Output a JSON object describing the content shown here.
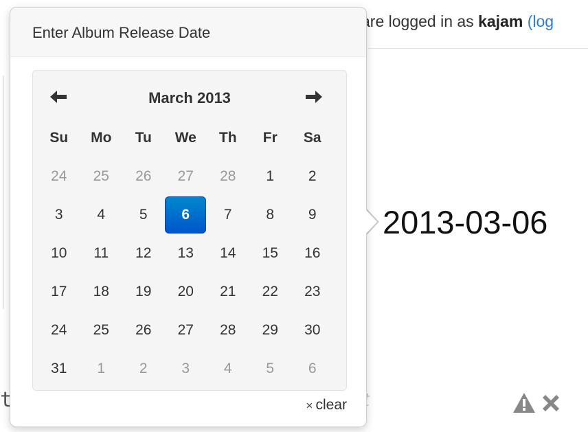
{
  "header": {
    "login_prefix": "are logged in as",
    "username": "kajam",
    "logout_fragment": "(log"
  },
  "background": {
    "left_fragment": "t",
    "mid_fragment": "t"
  },
  "release_date": {
    "value": "2013-03-06"
  },
  "popover": {
    "title": "Enter Album Release Date"
  },
  "datepicker": {
    "month_label": "March 2013",
    "prev_icon": "arrow-left-icon",
    "next_icon": "arrow-right-icon",
    "weekdays": [
      "Su",
      "Mo",
      "Tu",
      "We",
      "Th",
      "Fr",
      "Sa"
    ],
    "weeks": [
      [
        {
          "d": "24",
          "m": true
        },
        {
          "d": "25",
          "m": true
        },
        {
          "d": "26",
          "m": true
        },
        {
          "d": "27",
          "m": true
        },
        {
          "d": "28",
          "m": true
        },
        {
          "d": "1"
        },
        {
          "d": "2"
        }
      ],
      [
        {
          "d": "3"
        },
        {
          "d": "4"
        },
        {
          "d": "5"
        },
        {
          "d": "6",
          "s": true
        },
        {
          "d": "7"
        },
        {
          "d": "8"
        },
        {
          "d": "9"
        }
      ],
      [
        {
          "d": "10"
        },
        {
          "d": "11"
        },
        {
          "d": "12"
        },
        {
          "d": "13"
        },
        {
          "d": "14"
        },
        {
          "d": "15"
        },
        {
          "d": "16"
        }
      ],
      [
        {
          "d": "17"
        },
        {
          "d": "18"
        },
        {
          "d": "19"
        },
        {
          "d": "20"
        },
        {
          "d": "21"
        },
        {
          "d": "22"
        },
        {
          "d": "23"
        }
      ],
      [
        {
          "d": "24"
        },
        {
          "d": "25"
        },
        {
          "d": "26"
        },
        {
          "d": "27"
        },
        {
          "d": "28"
        },
        {
          "d": "29"
        },
        {
          "d": "30"
        }
      ],
      [
        {
          "d": "31"
        },
        {
          "d": "1",
          "m": true
        },
        {
          "d": "2",
          "m": true
        },
        {
          "d": "3",
          "m": true
        },
        {
          "d": "4",
          "m": true
        },
        {
          "d": "5",
          "m": true
        },
        {
          "d": "6",
          "m": true
        }
      ]
    ],
    "selected_color": "#0070cc",
    "clear_symbol": "×",
    "clear_label": "clear"
  },
  "actions": {
    "warning_icon": "warning-icon",
    "remove_icon": "close-icon",
    "icon_color": "#888888"
  }
}
